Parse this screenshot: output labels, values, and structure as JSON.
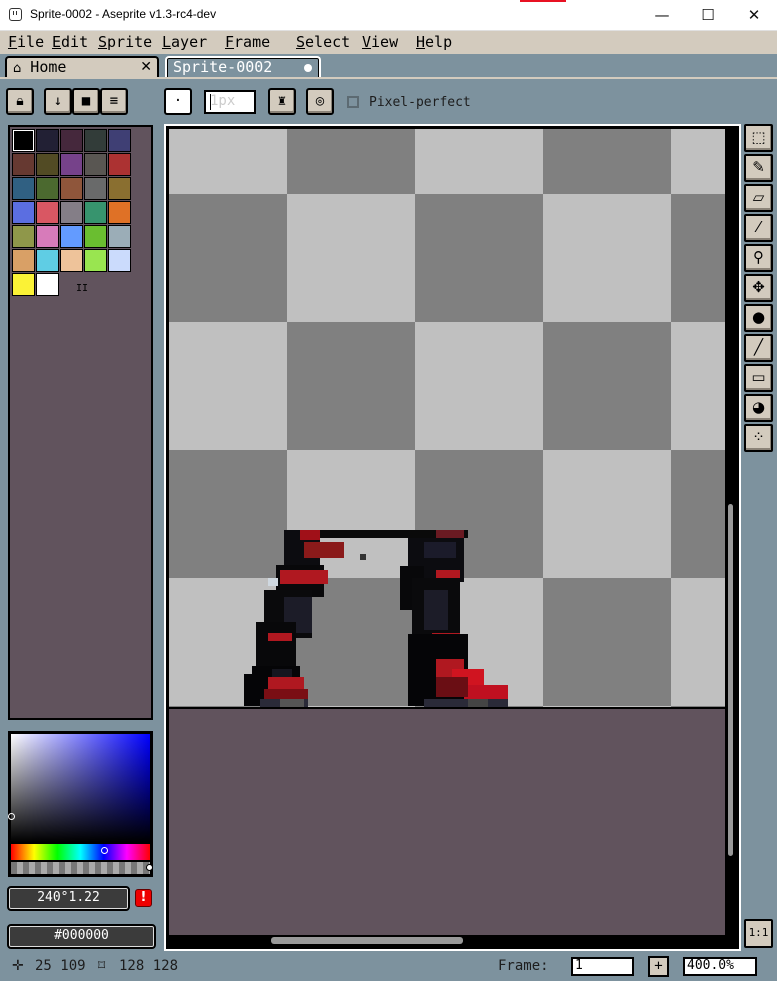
{
  "window": {
    "title": "Sprite-0002 - Aseprite v1.3-rc4-dev",
    "minimize": "—",
    "maximize": "☐",
    "close": "✕"
  },
  "menu": [
    "File",
    "Edit",
    "Sprite",
    "Layer",
    "Frame",
    "Select",
    "View",
    "Help"
  ],
  "tabs": {
    "home": {
      "label": "Home",
      "icon": "home-icon",
      "close": "✕"
    },
    "sprite": {
      "label": "Sprite-0002",
      "modified": true
    }
  },
  "toolbar": {
    "brush_size": "1px",
    "pixel_perfect_label": "Pixel-perfect",
    "pixel_perfect_checked": false
  },
  "palette": {
    "colors": [
      "#000000",
      "#222034",
      "#45283c",
      "#323c39",
      "#3f3f74",
      "#663931",
      "#524b24",
      "#76428a",
      "#595652",
      "#ac3232",
      "#306082",
      "#4b692f",
      "#8f563b",
      "#696a6a",
      "#8a6f30",
      "#5b6ee1",
      "#d95763",
      "#847e87",
      "#37946e",
      "#df7126",
      "#8f974a",
      "#d77bba",
      "#639bff",
      "#6abe30",
      "#9badb7",
      "#d9a066",
      "#5fcde4",
      "#eec39a",
      "#99e550",
      "#cbdbfc",
      "#fbf236",
      "#ffffff"
    ],
    "resize_mark": "II"
  },
  "color": {
    "hsv_label": "240°1.22",
    "hex_label": "#000000",
    "warning": "!"
  },
  "tools": [
    "marquee-tool",
    "pencil-tool",
    "eraser-tool",
    "eyedropper-tool",
    "zoom-tool",
    "move-tool",
    "paint-bucket-tool",
    "line-tool",
    "rectangle-tool",
    "blur-tool",
    "spray-tool"
  ],
  "status": {
    "cursor": "25 109",
    "size": "128 128",
    "frame_label": "Frame:",
    "frame_value": "1",
    "zoom": "400.0%",
    "one_to_one": "1:1"
  }
}
